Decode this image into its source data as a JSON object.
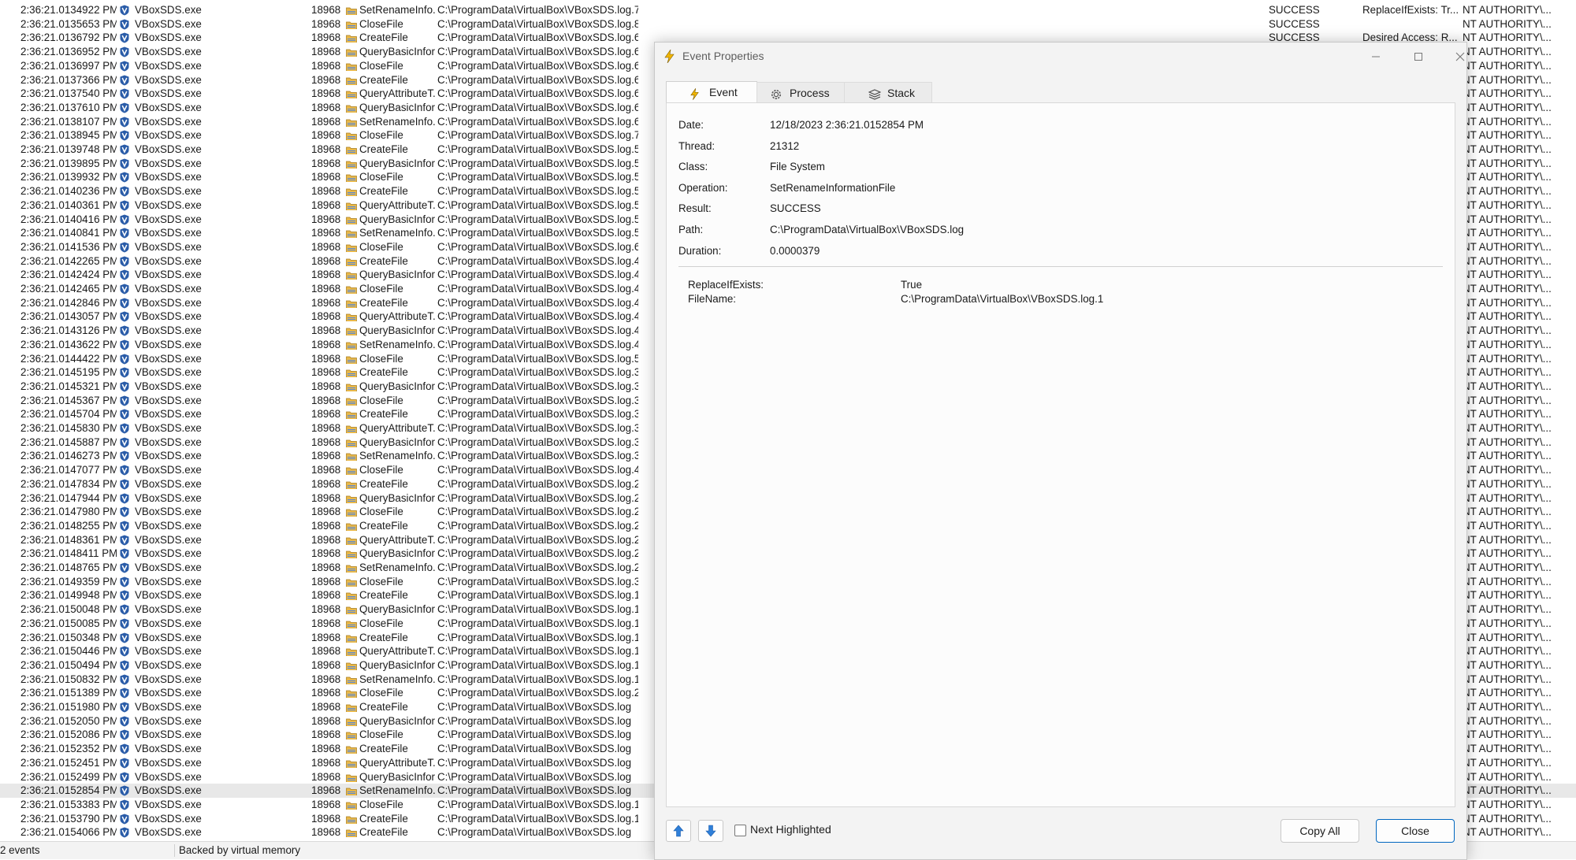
{
  "events": {
    "rows": [
      {
        "time": "2:36:21.0134922 PM",
        "process": "VBoxSDS.exe",
        "pid": "18968",
        "operation": "SetRenameInfo...",
        "path": "C:\\ProgramData\\VirtualBox\\VBoxSDS.log.7",
        "result": "SUCCESS",
        "detail": "ReplaceIfExists: Tr...",
        "user": "NT AUTHORITY\\..."
      },
      {
        "time": "2:36:21.0135653 PM",
        "process": "VBoxSDS.exe",
        "pid": "18968",
        "operation": "CloseFile",
        "path": "C:\\ProgramData\\VirtualBox\\VBoxSDS.log.8",
        "result": "SUCCESS",
        "detail": "",
        "user": "NT AUTHORITY\\..."
      },
      {
        "time": "2:36:21.0136792 PM",
        "process": "VBoxSDS.exe",
        "pid": "18968",
        "operation": "CreateFile",
        "path": "C:\\ProgramData\\VirtualBox\\VBoxSDS.log.6",
        "result": "SUCCESS",
        "detail": "Desired Access: R...",
        "user": "NT AUTHORITY\\..."
      },
      {
        "time": "2:36:21.0136952 PM",
        "process": "VBoxSDS.exe",
        "pid": "18968",
        "operation": "QueryBasicInfor...",
        "path": "C:\\ProgramData\\VirtualBox\\VBoxSDS.log.6",
        "result": "",
        "detail": "",
        "user": "NT AUTHORITY\\..."
      },
      {
        "time": "2:36:21.0136997 PM",
        "process": "VBoxSDS.exe",
        "pid": "18968",
        "operation": "CloseFile",
        "path": "C:\\ProgramData\\VirtualBox\\VBoxSDS.log.6",
        "result": "",
        "detail": "",
        "user": "NT AUTHORITY\\..."
      },
      {
        "time": "2:36:21.0137366 PM",
        "process": "VBoxSDS.exe",
        "pid": "18968",
        "operation": "CreateFile",
        "path": "C:\\ProgramData\\VirtualBox\\VBoxSDS.log.6",
        "result": "",
        "detail": "",
        "user": "NT AUTHORITY\\..."
      },
      {
        "time": "2:36:21.0137540 PM",
        "process": "VBoxSDS.exe",
        "pid": "18968",
        "operation": "QueryAttributeT...",
        "path": "C:\\ProgramData\\VirtualBox\\VBoxSDS.log.6",
        "result": "",
        "detail": "",
        "user": "NT AUTHORITY\\..."
      },
      {
        "time": "2:36:21.0137610 PM",
        "process": "VBoxSDS.exe",
        "pid": "18968",
        "operation": "QueryBasicInfor...",
        "path": "C:\\ProgramData\\VirtualBox\\VBoxSDS.log.6",
        "result": "",
        "detail": "",
        "user": "NT AUTHORITY\\..."
      },
      {
        "time": "2:36:21.0138107 PM",
        "process": "VBoxSDS.exe",
        "pid": "18968",
        "operation": "SetRenameInfo...",
        "path": "C:\\ProgramData\\VirtualBox\\VBoxSDS.log.6",
        "result": "",
        "detail": "",
        "user": "NT AUTHORITY\\..."
      },
      {
        "time": "2:36:21.0138945 PM",
        "process": "VBoxSDS.exe",
        "pid": "18968",
        "operation": "CloseFile",
        "path": "C:\\ProgramData\\VirtualBox\\VBoxSDS.log.7",
        "result": "",
        "detail": "",
        "user": "NT AUTHORITY\\..."
      },
      {
        "time": "2:36:21.0139748 PM",
        "process": "VBoxSDS.exe",
        "pid": "18968",
        "operation": "CreateFile",
        "path": "C:\\ProgramData\\VirtualBox\\VBoxSDS.log.5",
        "result": "",
        "detail": "",
        "user": "NT AUTHORITY\\..."
      },
      {
        "time": "2:36:21.0139895 PM",
        "process": "VBoxSDS.exe",
        "pid": "18968",
        "operation": "QueryBasicInfor...",
        "path": "C:\\ProgramData\\VirtualBox\\VBoxSDS.log.5",
        "result": "",
        "detail": "",
        "user": "NT AUTHORITY\\..."
      },
      {
        "time": "2:36:21.0139932 PM",
        "process": "VBoxSDS.exe",
        "pid": "18968",
        "operation": "CloseFile",
        "path": "C:\\ProgramData\\VirtualBox\\VBoxSDS.log.5",
        "result": "",
        "detail": "",
        "user": "NT AUTHORITY\\..."
      },
      {
        "time": "2:36:21.0140236 PM",
        "process": "VBoxSDS.exe",
        "pid": "18968",
        "operation": "CreateFile",
        "path": "C:\\ProgramData\\VirtualBox\\VBoxSDS.log.5",
        "result": "",
        "detail": "",
        "user": "NT AUTHORITY\\..."
      },
      {
        "time": "2:36:21.0140361 PM",
        "process": "VBoxSDS.exe",
        "pid": "18968",
        "operation": "QueryAttributeT...",
        "path": "C:\\ProgramData\\VirtualBox\\VBoxSDS.log.5",
        "result": "",
        "detail": "",
        "user": "NT AUTHORITY\\..."
      },
      {
        "time": "2:36:21.0140416 PM",
        "process": "VBoxSDS.exe",
        "pid": "18968",
        "operation": "QueryBasicInfor...",
        "path": "C:\\ProgramData\\VirtualBox\\VBoxSDS.log.5",
        "result": "",
        "detail": "",
        "user": "NT AUTHORITY\\..."
      },
      {
        "time": "2:36:21.0140841 PM",
        "process": "VBoxSDS.exe",
        "pid": "18968",
        "operation": "SetRenameInfo...",
        "path": "C:\\ProgramData\\VirtualBox\\VBoxSDS.log.5",
        "result": "",
        "detail": "",
        "user": "NT AUTHORITY\\..."
      },
      {
        "time": "2:36:21.0141536 PM",
        "process": "VBoxSDS.exe",
        "pid": "18968",
        "operation": "CloseFile",
        "path": "C:\\ProgramData\\VirtualBox\\VBoxSDS.log.6",
        "result": "",
        "detail": "",
        "user": "NT AUTHORITY\\..."
      },
      {
        "time": "2:36:21.0142265 PM",
        "process": "VBoxSDS.exe",
        "pid": "18968",
        "operation": "CreateFile",
        "path": "C:\\ProgramData\\VirtualBox\\VBoxSDS.log.4",
        "result": "",
        "detail": "",
        "user": "NT AUTHORITY\\..."
      },
      {
        "time": "2:36:21.0142424 PM",
        "process": "VBoxSDS.exe",
        "pid": "18968",
        "operation": "QueryBasicInfor...",
        "path": "C:\\ProgramData\\VirtualBox\\VBoxSDS.log.4",
        "result": "",
        "detail": "",
        "user": "NT AUTHORITY\\..."
      },
      {
        "time": "2:36:21.0142465 PM",
        "process": "VBoxSDS.exe",
        "pid": "18968",
        "operation": "CloseFile",
        "path": "C:\\ProgramData\\VirtualBox\\VBoxSDS.log.4",
        "result": "",
        "detail": "",
        "user": "NT AUTHORITY\\..."
      },
      {
        "time": "2:36:21.0142846 PM",
        "process": "VBoxSDS.exe",
        "pid": "18968",
        "operation": "CreateFile",
        "path": "C:\\ProgramData\\VirtualBox\\VBoxSDS.log.4",
        "result": "",
        "detail": "",
        "user": "NT AUTHORITY\\..."
      },
      {
        "time": "2:36:21.0143057 PM",
        "process": "VBoxSDS.exe",
        "pid": "18968",
        "operation": "QueryAttributeT...",
        "path": "C:\\ProgramData\\VirtualBox\\VBoxSDS.log.4",
        "result": "",
        "detail": "",
        "user": "NT AUTHORITY\\..."
      },
      {
        "time": "2:36:21.0143126 PM",
        "process": "VBoxSDS.exe",
        "pid": "18968",
        "operation": "QueryBasicInfor...",
        "path": "C:\\ProgramData\\VirtualBox\\VBoxSDS.log.4",
        "result": "",
        "detail": "",
        "user": "NT AUTHORITY\\..."
      },
      {
        "time": "2:36:21.0143622 PM",
        "process": "VBoxSDS.exe",
        "pid": "18968",
        "operation": "SetRenameInfo...",
        "path": "C:\\ProgramData\\VirtualBox\\VBoxSDS.log.4",
        "result": "",
        "detail": "",
        "user": "NT AUTHORITY\\..."
      },
      {
        "time": "2:36:21.0144422 PM",
        "process": "VBoxSDS.exe",
        "pid": "18968",
        "operation": "CloseFile",
        "path": "C:\\ProgramData\\VirtualBox\\VBoxSDS.log.5",
        "result": "",
        "detail": "",
        "user": "NT AUTHORITY\\..."
      },
      {
        "time": "2:36:21.0145195 PM",
        "process": "VBoxSDS.exe",
        "pid": "18968",
        "operation": "CreateFile",
        "path": "C:\\ProgramData\\VirtualBox\\VBoxSDS.log.3",
        "result": "",
        "detail": "",
        "user": "NT AUTHORITY\\..."
      },
      {
        "time": "2:36:21.0145321 PM",
        "process": "VBoxSDS.exe",
        "pid": "18968",
        "operation": "QueryBasicInfor...",
        "path": "C:\\ProgramData\\VirtualBox\\VBoxSDS.log.3",
        "result": "",
        "detail": "",
        "user": "NT AUTHORITY\\..."
      },
      {
        "time": "2:36:21.0145367 PM",
        "process": "VBoxSDS.exe",
        "pid": "18968",
        "operation": "CloseFile",
        "path": "C:\\ProgramData\\VirtualBox\\VBoxSDS.log.3",
        "result": "",
        "detail": "",
        "user": "NT AUTHORITY\\..."
      },
      {
        "time": "2:36:21.0145704 PM",
        "process": "VBoxSDS.exe",
        "pid": "18968",
        "operation": "CreateFile",
        "path": "C:\\ProgramData\\VirtualBox\\VBoxSDS.log.3",
        "result": "",
        "detail": "",
        "user": "NT AUTHORITY\\..."
      },
      {
        "time": "2:36:21.0145830 PM",
        "process": "VBoxSDS.exe",
        "pid": "18968",
        "operation": "QueryAttributeT...",
        "path": "C:\\ProgramData\\VirtualBox\\VBoxSDS.log.3",
        "result": "",
        "detail": "",
        "user": "NT AUTHORITY\\..."
      },
      {
        "time": "2:36:21.0145887 PM",
        "process": "VBoxSDS.exe",
        "pid": "18968",
        "operation": "QueryBasicInfor...",
        "path": "C:\\ProgramData\\VirtualBox\\VBoxSDS.log.3",
        "result": "",
        "detail": "",
        "user": "NT AUTHORITY\\..."
      },
      {
        "time": "2:36:21.0146273 PM",
        "process": "VBoxSDS.exe",
        "pid": "18968",
        "operation": "SetRenameInfo...",
        "path": "C:\\ProgramData\\VirtualBox\\VBoxSDS.log.3",
        "result": "",
        "detail": "",
        "user": "NT AUTHORITY\\..."
      },
      {
        "time": "2:36:21.0147077 PM",
        "process": "VBoxSDS.exe",
        "pid": "18968",
        "operation": "CloseFile",
        "path": "C:\\ProgramData\\VirtualBox\\VBoxSDS.log.4",
        "result": "",
        "detail": "",
        "user": "NT AUTHORITY\\..."
      },
      {
        "time": "2:36:21.0147834 PM",
        "process": "VBoxSDS.exe",
        "pid": "18968",
        "operation": "CreateFile",
        "path": "C:\\ProgramData\\VirtualBox\\VBoxSDS.log.2",
        "result": "",
        "detail": "",
        "user": "NT AUTHORITY\\..."
      },
      {
        "time": "2:36:21.0147944 PM",
        "process": "VBoxSDS.exe",
        "pid": "18968",
        "operation": "QueryBasicInfor...",
        "path": "C:\\ProgramData\\VirtualBox\\VBoxSDS.log.2",
        "result": "",
        "detail": "",
        "user": "NT AUTHORITY\\..."
      },
      {
        "time": "2:36:21.0147980 PM",
        "process": "VBoxSDS.exe",
        "pid": "18968",
        "operation": "CloseFile",
        "path": "C:\\ProgramData\\VirtualBox\\VBoxSDS.log.2",
        "result": "",
        "detail": "",
        "user": "NT AUTHORITY\\..."
      },
      {
        "time": "2:36:21.0148255 PM",
        "process": "VBoxSDS.exe",
        "pid": "18968",
        "operation": "CreateFile",
        "path": "C:\\ProgramData\\VirtualBox\\VBoxSDS.log.2",
        "result": "",
        "detail": "",
        "user": "NT AUTHORITY\\..."
      },
      {
        "time": "2:36:21.0148361 PM",
        "process": "VBoxSDS.exe",
        "pid": "18968",
        "operation": "QueryAttributeT...",
        "path": "C:\\ProgramData\\VirtualBox\\VBoxSDS.log.2",
        "result": "",
        "detail": "",
        "user": "NT AUTHORITY\\..."
      },
      {
        "time": "2:36:21.0148411 PM",
        "process": "VBoxSDS.exe",
        "pid": "18968",
        "operation": "QueryBasicInfor...",
        "path": "C:\\ProgramData\\VirtualBox\\VBoxSDS.log.2",
        "result": "",
        "detail": "",
        "user": "NT AUTHORITY\\..."
      },
      {
        "time": "2:36:21.0148765 PM",
        "process": "VBoxSDS.exe",
        "pid": "18968",
        "operation": "SetRenameInfo...",
        "path": "C:\\ProgramData\\VirtualBox\\VBoxSDS.log.2",
        "result": "",
        "detail": "",
        "user": "NT AUTHORITY\\..."
      },
      {
        "time": "2:36:21.0149359 PM",
        "process": "VBoxSDS.exe",
        "pid": "18968",
        "operation": "CloseFile",
        "path": "C:\\ProgramData\\VirtualBox\\VBoxSDS.log.3",
        "result": "",
        "detail": "",
        "user": "NT AUTHORITY\\..."
      },
      {
        "time": "2:36:21.0149948 PM",
        "process": "VBoxSDS.exe",
        "pid": "18968",
        "operation": "CreateFile",
        "path": "C:\\ProgramData\\VirtualBox\\VBoxSDS.log.1",
        "result": "",
        "detail": "",
        "user": "NT AUTHORITY\\..."
      },
      {
        "time": "2:36:21.0150048 PM",
        "process": "VBoxSDS.exe",
        "pid": "18968",
        "operation": "QueryBasicInfor...",
        "path": "C:\\ProgramData\\VirtualBox\\VBoxSDS.log.1",
        "result": "",
        "detail": "",
        "user": "NT AUTHORITY\\..."
      },
      {
        "time": "2:36:21.0150085 PM",
        "process": "VBoxSDS.exe",
        "pid": "18968",
        "operation": "CloseFile",
        "path": "C:\\ProgramData\\VirtualBox\\VBoxSDS.log.1",
        "result": "",
        "detail": "",
        "user": "NT AUTHORITY\\..."
      },
      {
        "time": "2:36:21.0150348 PM",
        "process": "VBoxSDS.exe",
        "pid": "18968",
        "operation": "CreateFile",
        "path": "C:\\ProgramData\\VirtualBox\\VBoxSDS.log.1",
        "result": "",
        "detail": "",
        "user": "NT AUTHORITY\\..."
      },
      {
        "time": "2:36:21.0150446 PM",
        "process": "VBoxSDS.exe",
        "pid": "18968",
        "operation": "QueryAttributeT...",
        "path": "C:\\ProgramData\\VirtualBox\\VBoxSDS.log.1",
        "result": "",
        "detail": "",
        "user": "NT AUTHORITY\\..."
      },
      {
        "time": "2:36:21.0150494 PM",
        "process": "VBoxSDS.exe",
        "pid": "18968",
        "operation": "QueryBasicInfor...",
        "path": "C:\\ProgramData\\VirtualBox\\VBoxSDS.log.1",
        "result": "",
        "detail": "",
        "user": "NT AUTHORITY\\..."
      },
      {
        "time": "2:36:21.0150832 PM",
        "process": "VBoxSDS.exe",
        "pid": "18968",
        "operation": "SetRenameInfo...",
        "path": "C:\\ProgramData\\VirtualBox\\VBoxSDS.log.1",
        "result": "",
        "detail": "",
        "user": "NT AUTHORITY\\..."
      },
      {
        "time": "2:36:21.0151389 PM",
        "process": "VBoxSDS.exe",
        "pid": "18968",
        "operation": "CloseFile",
        "path": "C:\\ProgramData\\VirtualBox\\VBoxSDS.log.2",
        "result": "",
        "detail": "",
        "user": "NT AUTHORITY\\..."
      },
      {
        "time": "2:36:21.0151980 PM",
        "process": "VBoxSDS.exe",
        "pid": "18968",
        "operation": "CreateFile",
        "path": "C:\\ProgramData\\VirtualBox\\VBoxSDS.log",
        "result": "",
        "detail": "",
        "user": "NT AUTHORITY\\..."
      },
      {
        "time": "2:36:21.0152050 PM",
        "process": "VBoxSDS.exe",
        "pid": "18968",
        "operation": "QueryBasicInfor...",
        "path": "C:\\ProgramData\\VirtualBox\\VBoxSDS.log",
        "result": "",
        "detail": "",
        "user": "NT AUTHORITY\\..."
      },
      {
        "time": "2:36:21.0152086 PM",
        "process": "VBoxSDS.exe",
        "pid": "18968",
        "operation": "CloseFile",
        "path": "C:\\ProgramData\\VirtualBox\\VBoxSDS.log",
        "result": "",
        "detail": "",
        "user": "NT AUTHORITY\\..."
      },
      {
        "time": "2:36:21.0152352 PM",
        "process": "VBoxSDS.exe",
        "pid": "18968",
        "operation": "CreateFile",
        "path": "C:\\ProgramData\\VirtualBox\\VBoxSDS.log",
        "result": "",
        "detail": "",
        "user": "NT AUTHORITY\\..."
      },
      {
        "time": "2:36:21.0152451 PM",
        "process": "VBoxSDS.exe",
        "pid": "18968",
        "operation": "QueryAttributeT...",
        "path": "C:\\ProgramData\\VirtualBox\\VBoxSDS.log",
        "result": "",
        "detail": "",
        "user": "NT AUTHORITY\\..."
      },
      {
        "time": "2:36:21.0152499 PM",
        "process": "VBoxSDS.exe",
        "pid": "18968",
        "operation": "QueryBasicInfor...",
        "path": "C:\\ProgramData\\VirtualBox\\VBoxSDS.log",
        "result": "",
        "detail": "",
        "user": "NT AUTHORITY\\..."
      },
      {
        "time": "2:36:21.0152854 PM",
        "process": "VBoxSDS.exe",
        "pid": "18968",
        "operation": "SetRenameInfo...",
        "path": "C:\\ProgramData\\VirtualBox\\VBoxSDS.log",
        "result": "",
        "detail": "",
        "user": "NT AUTHORITY\\...",
        "selected": true
      },
      {
        "time": "2:36:21.0153383 PM",
        "process": "VBoxSDS.exe",
        "pid": "18968",
        "operation": "CloseFile",
        "path": "C:\\ProgramData\\VirtualBox\\VBoxSDS.log.1",
        "result": "",
        "detail": "",
        "user": "NT AUTHORITY\\..."
      },
      {
        "time": "2:36:21.0153790 PM",
        "process": "VBoxSDS.exe",
        "pid": "18968",
        "operation": "CreateFile",
        "path": "C:\\ProgramData\\VirtualBox\\VBoxSDS.log.11",
        "result": "",
        "detail": "",
        "user": "NT AUTHORITY\\..."
      },
      {
        "time": "2:36:21.0154066 PM",
        "process": "VBoxSDS.exe",
        "pid": "18968",
        "operation": "CreateFile",
        "path": "C:\\ProgramData\\VirtualBox\\VBoxSDS.log",
        "result": "",
        "detail": "",
        "user": "NT AUTHORITY\\..."
      }
    ]
  },
  "statusbar": {
    "events": "2 events",
    "memory": "Backed by virtual memory"
  },
  "dialog": {
    "title": "Event Properties",
    "tabs": [
      {
        "label": "Event",
        "icon": "lightning-icon",
        "active": true
      },
      {
        "label": "Process",
        "icon": "gear-icon"
      },
      {
        "label": "Stack",
        "icon": "stack-icon"
      }
    ],
    "properties": [
      {
        "label": "Date:",
        "value": "12/18/2023 2:36:21.0152854 PM"
      },
      {
        "label": "Thread:",
        "value": "21312"
      },
      {
        "label": "Class:",
        "value": "File System"
      },
      {
        "label": "Operation:",
        "value": "SetRenameInformationFile"
      },
      {
        "label": "Result:",
        "value": "SUCCESS"
      },
      {
        "label": "Path:",
        "value": "C:\\ProgramData\\VirtualBox\\VBoxSDS.log"
      },
      {
        "label": "Duration:",
        "value": "0.0000379"
      }
    ],
    "details": [
      {
        "label": "ReplaceIfExists:",
        "value": "True"
      },
      {
        "label": "FileName:",
        "value": "C:\\ProgramData\\VirtualBox\\VBoxSDS.log.1"
      }
    ],
    "next_highlighted_label": "Next Highlighted",
    "copy_all_label": "Copy All",
    "close_label": "Close"
  },
  "colors": {
    "lightning": "#f2b600",
    "process_icon": "#2a5ca8",
    "selection": "#e8e8e8",
    "accent": "#0067c0"
  }
}
